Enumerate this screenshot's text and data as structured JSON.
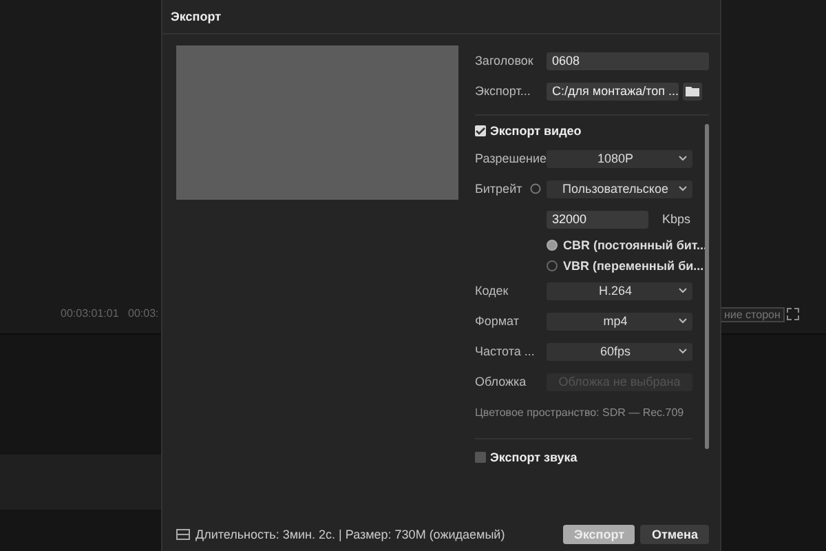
{
  "background": {
    "timecodes": [
      "00:03:01:01",
      "00:03:"
    ],
    "aspect_button": "ние сторон"
  },
  "dialog": {
    "title": "Экспорт",
    "fields": [
      {
        "label": "Заголовок",
        "value": "0608",
        "kind": "text"
      },
      {
        "label": "Экспорт...",
        "value": "C:/для монтажа/топ ...",
        "kind": "path"
      }
    ],
    "video_section": {
      "label": "Экспорт видео",
      "checked": true
    },
    "rows": [
      {
        "kind": "select",
        "label": "Разрешение",
        "value": "1080P"
      },
      {
        "kind": "select",
        "label": "Битрейт",
        "value": "Пользовательское",
        "info": true
      },
      {
        "kind": "number",
        "value": "32000",
        "unit": "Kbps"
      },
      {
        "kind": "radio",
        "label": "CBR (постоянный бит...",
        "selected": true
      },
      {
        "kind": "radio",
        "label": "VBR (переменный би...",
        "selected": false
      },
      {
        "kind": "select",
        "label": "Кодек",
        "value": "H.264"
      },
      {
        "kind": "select",
        "label": "Формат",
        "value": "mp4"
      },
      {
        "kind": "select",
        "label": "Частота ...",
        "value": "60fps"
      },
      {
        "kind": "disabled",
        "label": "Обложка",
        "placeholder": "Обложка не выбрана"
      },
      {
        "kind": "note",
        "label": "Цветовое пространство: SDR — Rec.709"
      }
    ],
    "audio_section": {
      "label": "Экспорт звука",
      "checked": false
    },
    "footer": {
      "info": "Длительность: 3мин. 2с. | Размер: 730M (ожидаемый)",
      "buttons": [
        "Экспорт",
        "Отмена"
      ]
    }
  }
}
